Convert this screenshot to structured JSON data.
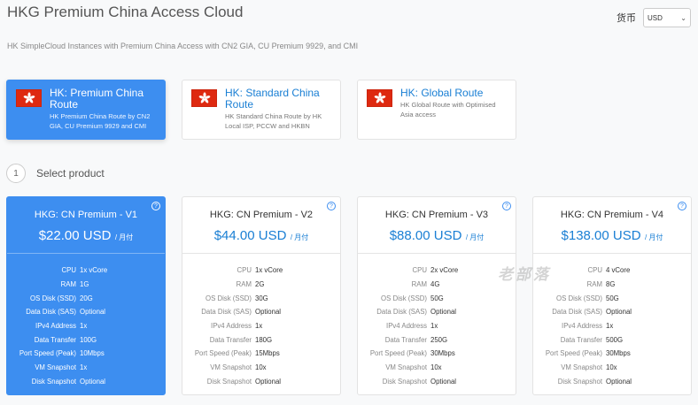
{
  "header": {
    "title": "HKG Premium China Access Cloud",
    "currency_label": "货币",
    "currency_value": "USD",
    "subtitle": "HK SimpleCloud Instances with Premium China Access with CN2 GIA, CU Premium 9929, and CMI"
  },
  "categories": [
    {
      "title": "HK: Premium China Route",
      "desc": "HK Premium China Route by CN2 GIA, CU Premium 9929 and CMI",
      "active": true
    },
    {
      "title": "HK: Standard China Route",
      "desc": "HK Standard China Route by HK Local ISP, PCCW and HKBN",
      "active": false
    },
    {
      "title": "HK: Global Route",
      "desc": "HK Global Route with Optimised Asia access",
      "active": false
    }
  ],
  "step": {
    "number": "1",
    "label": "Select product"
  },
  "spec_labels": [
    "CPU",
    "RAM",
    "OS Disk (SSD)",
    "Data Disk (SAS)",
    "IPv4 Address",
    "Data Transfer",
    "Port Speed (Peak)",
    "VM Snapshot",
    "Disk Snapshot"
  ],
  "products": [
    {
      "name": "HKG: CN Premium - V1",
      "price": "$22.00 USD",
      "cycle": "/ 月付",
      "active": true,
      "specs": [
        "1x vCore",
        "1G",
        "20G",
        "Optional",
        "1x",
        "100G",
        "10Mbps",
        "1x",
        "Optional"
      ]
    },
    {
      "name": "HKG: CN Premium - V2",
      "price": "$44.00 USD",
      "cycle": "/ 月付",
      "active": false,
      "specs": [
        "1x vCore",
        "2G",
        "30G",
        "Optional",
        "1x",
        "180G",
        "15Mbps",
        "10x",
        "Optional"
      ]
    },
    {
      "name": "HKG: CN Premium - V3",
      "price": "$88.00 USD",
      "cycle": "/ 月付",
      "active": false,
      "specs": [
        "2x vCore",
        "4G",
        "50G",
        "Optional",
        "1x",
        "250G",
        "30Mbps",
        "10x",
        "Optional"
      ]
    },
    {
      "name": "HKG: CN Premium - V4",
      "price": "$138.00 USD",
      "cycle": "/ 月付",
      "active": false,
      "specs": [
        "4 vCore",
        "8G",
        "50G",
        "Optional",
        "1x",
        "500G",
        "30Mbps",
        "10x",
        "Optional"
      ]
    }
  ],
  "watermark": "老部落",
  "colors": {
    "accent": "#3d8ef0",
    "link": "#1a7fd4",
    "flag_red": "#de2910"
  }
}
